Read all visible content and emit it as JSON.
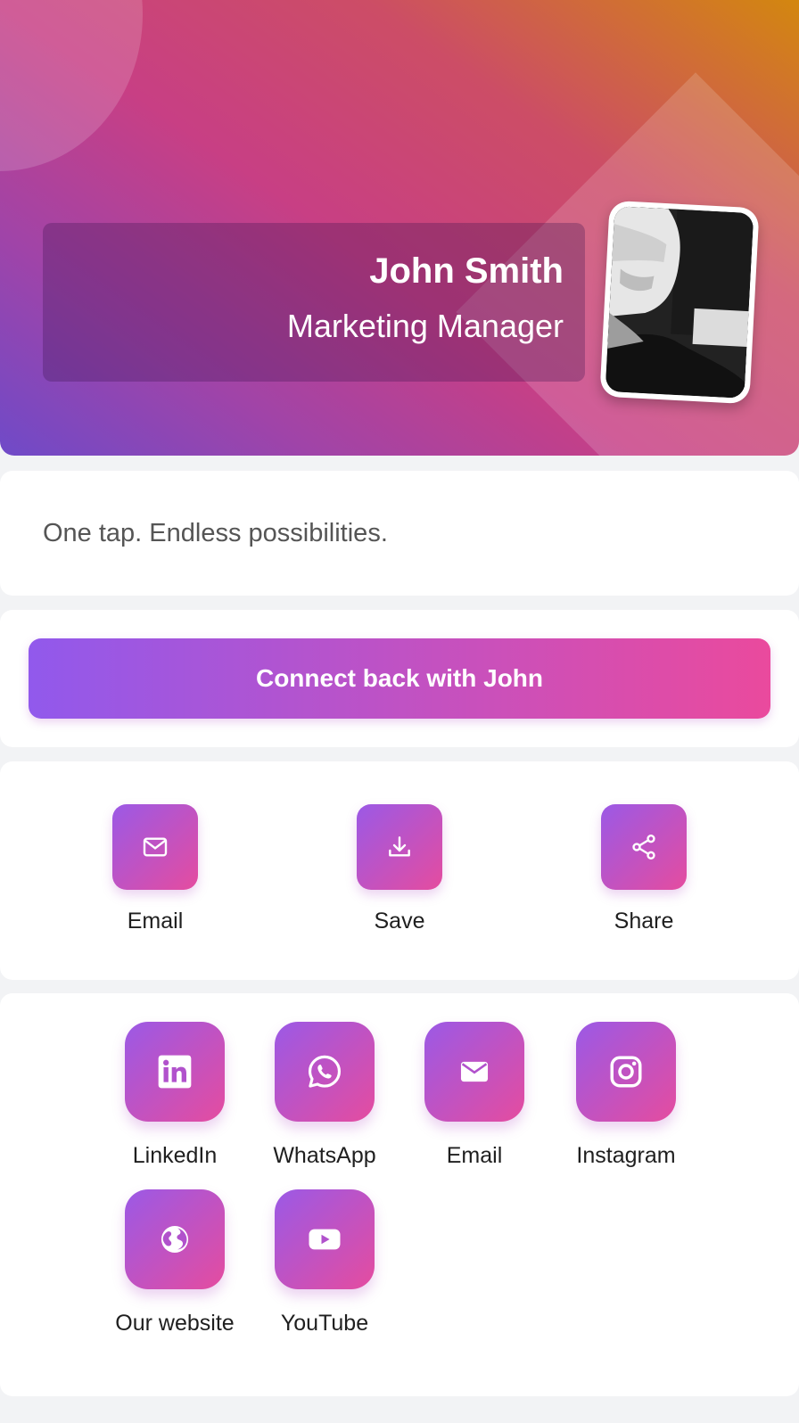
{
  "profile": {
    "name": "John Smith",
    "title": "Marketing Manager",
    "photo_alt": "profile-photo"
  },
  "tagline": "One tap. Endless possibilities.",
  "connect_button": "Connect back with John",
  "quick_actions": [
    {
      "label": "Email",
      "icon": "mail-outline-icon"
    },
    {
      "label": "Save",
      "icon": "download-icon"
    },
    {
      "label": "Share",
      "icon": "share-icon"
    }
  ],
  "social_links": [
    {
      "label": "LinkedIn",
      "icon": "linkedin-icon"
    },
    {
      "label": "WhatsApp",
      "icon": "whatsapp-icon"
    },
    {
      "label": "Email",
      "icon": "mail-icon"
    },
    {
      "label": "Instagram",
      "icon": "instagram-icon"
    },
    {
      "label": "Our website",
      "icon": "globe-icon"
    },
    {
      "label": "YouTube",
      "icon": "youtube-icon"
    }
  ],
  "colors": {
    "accent_start": "#9159ec",
    "accent_end": "#ea4a9d",
    "page_background": "#f2f3f5"
  }
}
